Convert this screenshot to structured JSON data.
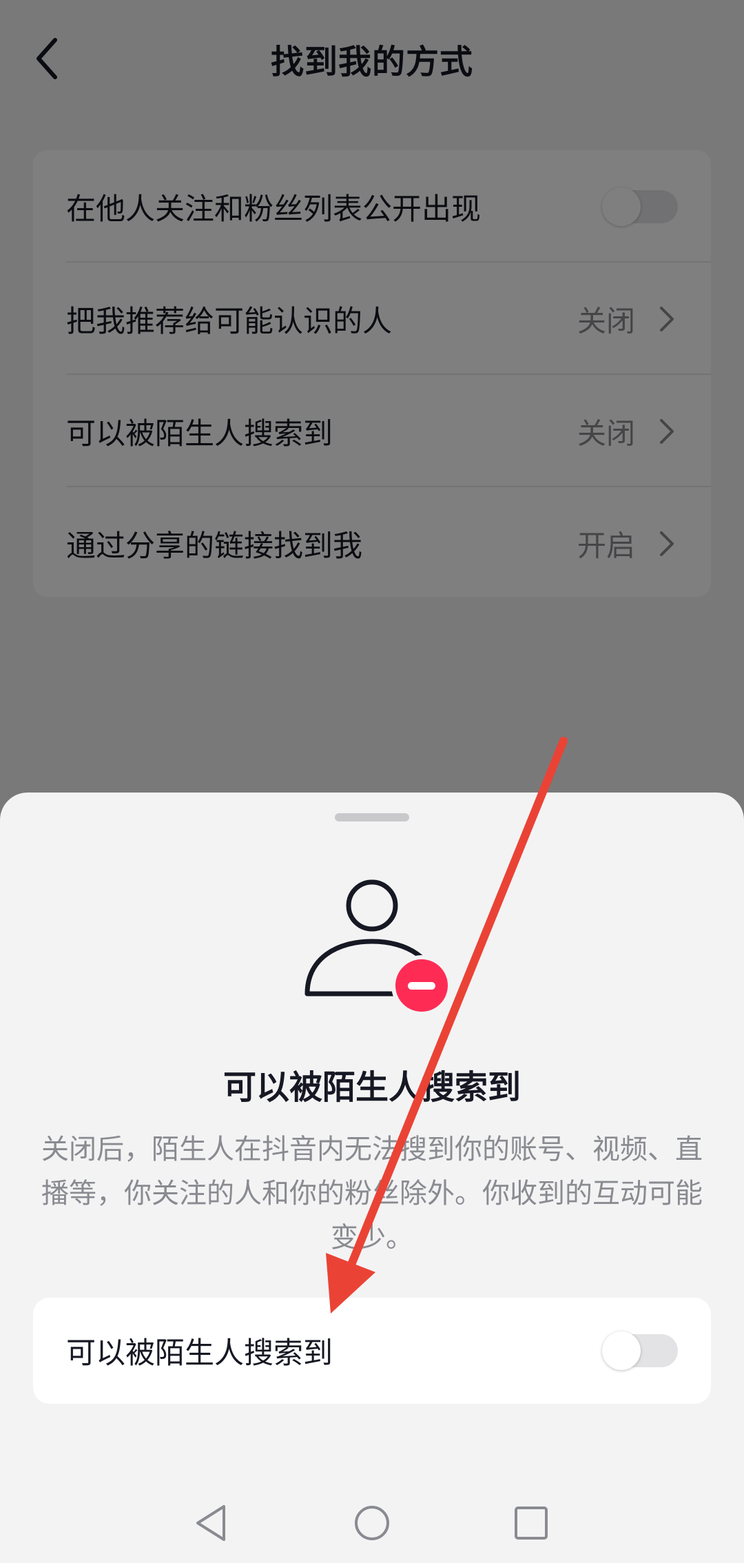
{
  "header": {
    "title": "找到我的方式"
  },
  "settings": [
    {
      "label": "在他人关注和粉丝列表公开出现",
      "type": "toggle",
      "enabled": false
    },
    {
      "label": "把我推荐给可能认识的人",
      "type": "link",
      "value": "关闭"
    },
    {
      "label": "可以被陌生人搜索到",
      "type": "link",
      "value": "关闭"
    },
    {
      "label": "通过分享的链接找到我",
      "type": "link",
      "value": "开启"
    }
  ],
  "sheet": {
    "icon": "user-remove-icon",
    "title": "可以被陌生人搜索到",
    "description": "关闭后，陌生人在抖音内无法搜到你的账号、视频、直播等，你关注的人和你的粉丝除外。你收到的互动可能变少。",
    "option_label": "可以被陌生人搜索到",
    "option_enabled": false
  },
  "nav": {
    "icons": [
      "back-triangle-icon",
      "home-circle-icon",
      "recents-square-icon"
    ]
  },
  "colors": {
    "accent_red": "#fe2c55",
    "annotation_arrow": "#ea4335",
    "overlay": "rgba(0,0,0,0.5)"
  }
}
